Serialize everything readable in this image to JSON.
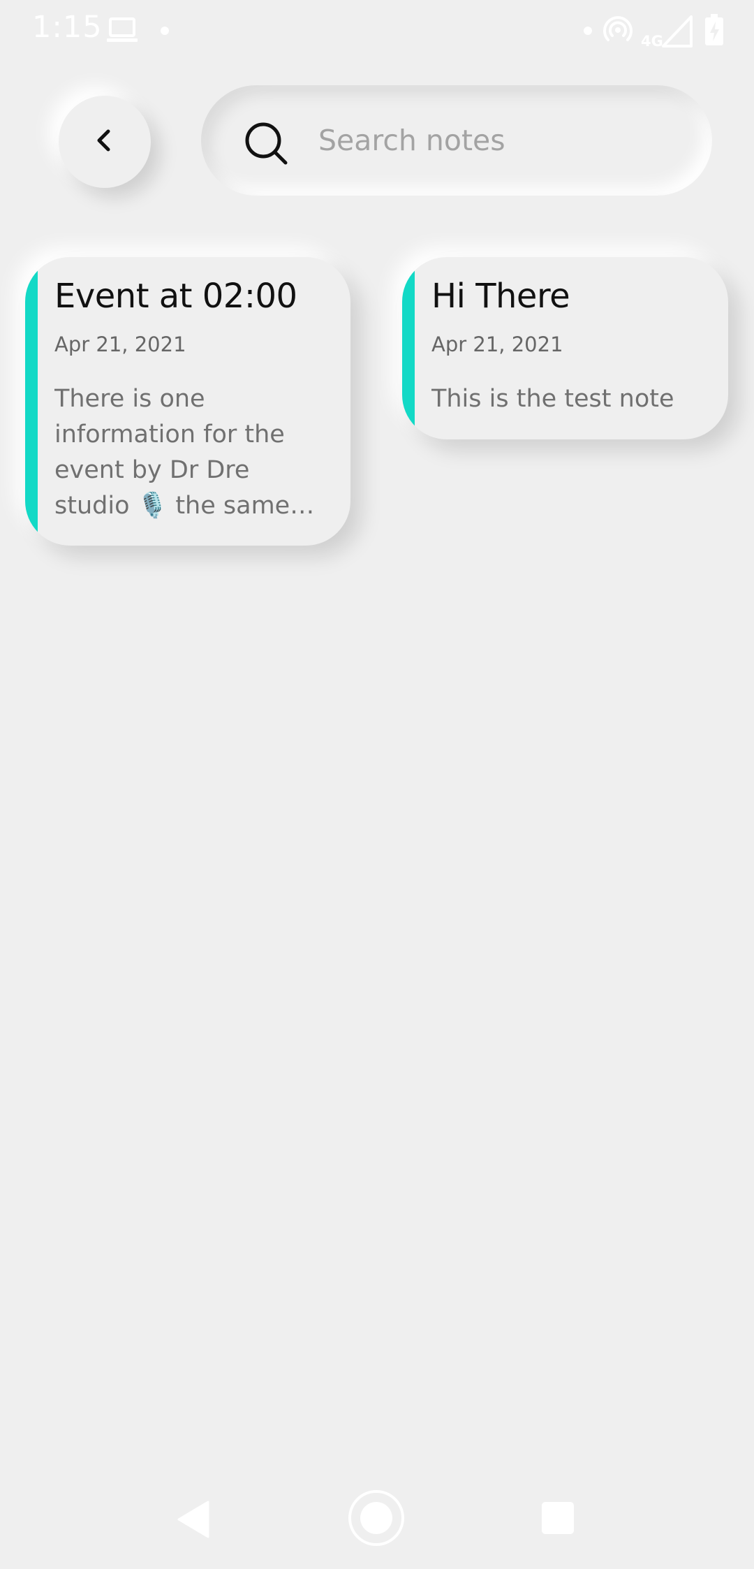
{
  "status_bar": {
    "time": "1:15",
    "network_label": "4G"
  },
  "colors": {
    "background": "#efefef",
    "accent": "#13d9c6"
  },
  "header": {
    "back_icon": "chevron-left-icon"
  },
  "search": {
    "placeholder": "Search notes",
    "value": "",
    "icon": "search-icon"
  },
  "notes": [
    {
      "title": "Event at 02:00",
      "date": "Apr 21, 2021",
      "preview": "There is one information for the event by Dr Dre studio 🎙️ the same time as the event"
    },
    {
      "title": "Hi There",
      "date": "Apr 21, 2021",
      "preview": "This is the test note"
    }
  ]
}
